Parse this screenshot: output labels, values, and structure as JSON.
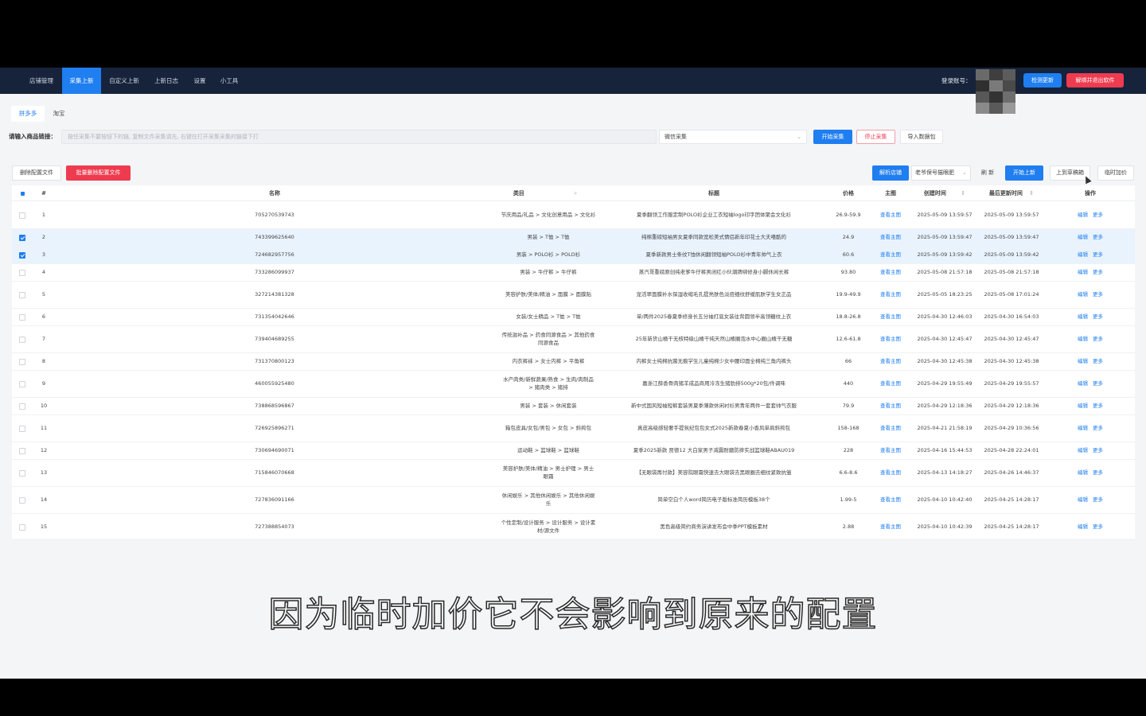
{
  "nav": {
    "items": [
      "店铺管理",
      "采集上新",
      "自定义上新",
      "上新日志",
      "设置",
      "小工具"
    ],
    "active_index": 1,
    "login_label": "登录账号：",
    "check_update": "检测更新",
    "unbind_exit": "解绑并退出软件"
  },
  "platform_tabs": {
    "items": [
      "拼多多",
      "淘宝"
    ],
    "active_index": 0
  },
  "collect": {
    "url_label": "请输入商品链接：",
    "url_placeholder": "按住采集不要按钮下的链, 复制文件采集请先, 右键在打开采集采集的链接下打",
    "mode_value": "微信采集",
    "start_button": "开始采集",
    "stop_button": "停止采集",
    "import_button": "导入数据包"
  },
  "toolbar": {
    "delete_config": "删除配置文件",
    "batch_delete_config": "批量删除配置文件",
    "parse_shop": "解析店铺",
    "shop_select": "老爷保号猫眼肥",
    "refresh": "刷 新",
    "start_upload": "开始上新",
    "upload_draft": "上到草稿箱",
    "temp_markup": "临时加价"
  },
  "table": {
    "headers": {
      "index": "#",
      "name": "名称",
      "category": "类目",
      "title": "标题",
      "price": "价格",
      "main_image": "主图",
      "created": "创建时间",
      "updated": "最后更新时间",
      "ops": "操作",
      "sort_icon": "⇕",
      "search_icon": "⌕"
    },
    "view_image": "查看主图",
    "edit": "编辑",
    "more": "更多",
    "rows": [
      {
        "index": "1",
        "name": "705270539743",
        "category": "节庆用品/礼品 > 文化创意用品 > 文化衫",
        "title": "夏季翻领工作服定制POLO衫企业工衣短袖logo印字团体聚会文化衫",
        "price": "26.9-59.9",
        "created": "2025-05-09 13:59:57",
        "updated": "2025-05-09 13:59:57",
        "checked": false
      },
      {
        "index": "2",
        "name": "743399625640",
        "category": "男装 > T恤 > T恤",
        "title": "纯棉重磅短袖男女夏季同款宽松美式情侣新年印花士大夫嘻酷的",
        "price": "24.9",
        "created": "2025-05-09 13:59:47",
        "updated": "2025-05-09 13:59:47",
        "checked": true
      },
      {
        "index": "3",
        "name": "724682957756",
        "category": "男装 > POLO衫 > POLO衫",
        "title": "夏季新款男士条纹T恤休闲翻领短袖POLO衫中青年帅气上衣",
        "price": "60.6",
        "created": "2025-05-09 13:59:42",
        "updated": "2025-05-09 13:59:42",
        "checked": true
      },
      {
        "index": "4",
        "name": "733286099937",
        "category": "男装 > 牛仔裤 > 牛仔裤",
        "title": "蒸汽哥重磅原创纯老爹牛仔裤男闭红小伙潮牌绑修身小脚休闲长裤",
        "price": "93.80",
        "created": "2025-05-08 21:57:18",
        "updated": "2025-05-08 21:57:18",
        "checked": false
      },
      {
        "index": "5",
        "name": "327214381328",
        "category": "美容护肤/美体/精油 > 面膜 > 面膜贴",
        "title": "宠活翠面膜补水保湿收缩毛孔提亮肤色淡痘细纹舒缓肌肤学生女正品",
        "price": "19.9-49.9",
        "created": "2025-05-05 18:23:25",
        "updated": "2025-05-08 17:01:24",
        "checked": false
      },
      {
        "index": "6",
        "name": "731354042646",
        "category": "女装/女士精品 > T恤 > T恤",
        "title": "单/两件2025春夏季修身长五分袖打底女装往背圆领半高领糖纹上衣",
        "price": "18.8-26.8",
        "created": "2025-04-30 12:46:03",
        "updated": "2025-04-30 16:54:03",
        "checked": false
      },
      {
        "index": "7",
        "name": "739404689255",
        "category": "传统滋补品 > 药食同源食品 > 其他药食同源食品",
        "title": "25年新货山楂干无核特级山楂干纯天然山楂圈泡水中心圈山楂干无糖",
        "price": "12.6-61.8",
        "created": "2025-04-30 12:45:47",
        "updated": "2025-04-30 12:45:47",
        "checked": false
      },
      {
        "index": "8",
        "name": "731370800123",
        "category": "内衣裤袜 > 女士内裤 > 平角裤",
        "title": "内裤女士纯棉抗菌无痕学生儿童纯棉少女中腰印面全棉纯三角内裤头",
        "price": "66",
        "created": "2025-04-30 12:45:38",
        "updated": "2025-04-30 12:45:38",
        "checked": false
      },
      {
        "index": "9",
        "name": "460055925480",
        "category": "水产肉类/新鲜蔬果/熟食 > 生肉/肉制品 > 猪肉类 > 猪排",
        "title": "嘉浙江薛香骨肉猪羊成品商用冷冻生猪肋排500g*20包/件调味",
        "price": "440",
        "created": "2025-04-29 19:55:49",
        "updated": "2025-04-29 19:55:57",
        "checked": false
      },
      {
        "index": "10",
        "name": "738868596867",
        "category": "男装 > 套装 > 休闲套装",
        "title": "新中式国风短袖短裤套装男夏季薄款休闲衬衫男青年两件一套套帅气衣服",
        "price": "79.9",
        "created": "2025-04-29 12:18:36",
        "updated": "2025-04-29 12:18:36",
        "checked": false
      },
      {
        "index": "11",
        "name": "726925896271",
        "category": "箱包皮具/女包/男包 > 女包 > 斜挎包",
        "title": "真皮高级感轻奢手提氛纪包包女式2025新款春夏小香风单肩斜挎包",
        "price": "158-168",
        "created": "2025-04-21 21:58:19",
        "updated": "2025-04-29 10:36:56",
        "checked": false
      },
      {
        "index": "12",
        "name": "730694690071",
        "category": "运动鞋 > 篮球鞋 > 篮球鞋",
        "title": "夏季2025新款 贾德12 大白家男子减震耐磨防摔实战篮球鞋ABAU019",
        "price": "228",
        "created": "2025-04-16 15:44:53",
        "updated": "2025-04-28 22:24:01",
        "checked": false
      },
      {
        "index": "13",
        "name": "715846070668",
        "category": "美容护肤/美体/精油 > 男士护理 > 男士眼霜",
        "title": "【无眼袋再付款】美容院眼霜快速去大眼袋去黑眼圈去细纹紧致抗皱",
        "price": "6.6-8.6",
        "created": "2025-04-13 14:18:27",
        "updated": "2025-04-26 14:46:37",
        "checked": false
      },
      {
        "index": "14",
        "name": "727836091166",
        "category": "休闲娱乐 > 其他休闲娱乐 > 其他休闲娱乐",
        "title": "简单空白个人word简历电子版标准简历模板38个",
        "price": "1.99-5",
        "created": "2025-04-10 10:42:40",
        "updated": "2025-04-25 14:28:17",
        "checked": false
      },
      {
        "index": "15",
        "name": "727388854073",
        "category": "个性定制/设计服务 > 设计服务 > 设计素材/源文件",
        "title": "黑色高级简约商务演讲发布会中季PPT模板素材",
        "price": "2.88",
        "created": "2025-04-10 10:42:39",
        "updated": "2025-04-25 14:28:17",
        "checked": false
      }
    ]
  },
  "subtitle": "因为临时加价它不会影响到原来的配置",
  "colors": {
    "nav_bg": "#16233b",
    "accent": "#1f7ef0",
    "danger": "#ee3b4f",
    "selected_row": "#e9f3fd"
  }
}
